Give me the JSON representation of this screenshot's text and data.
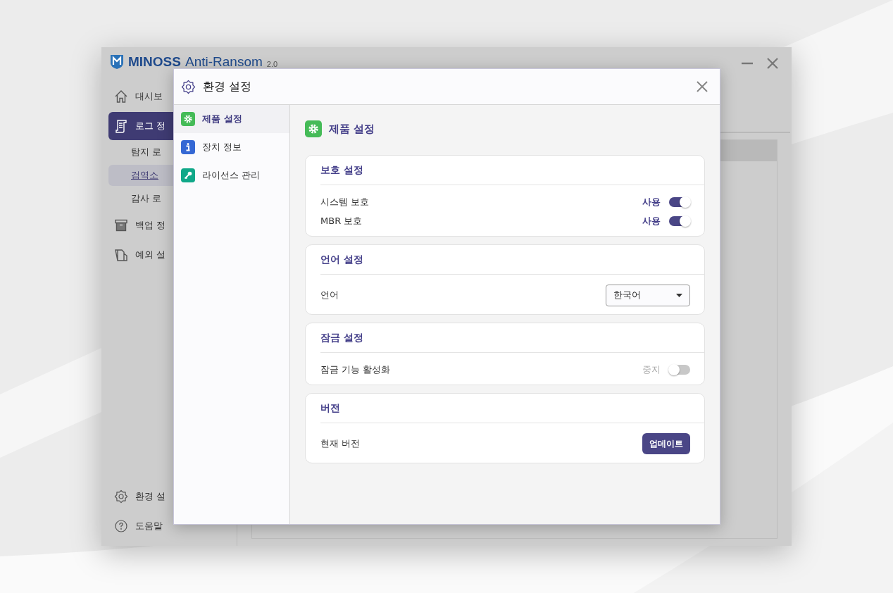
{
  "app": {
    "brand": "MINOSS",
    "product": "Anti-Ransom",
    "version": "2.0"
  },
  "sidebar": {
    "items": [
      {
        "label": "대시보",
        "selected": false
      },
      {
        "label": "로그 정",
        "selected": true,
        "children": [
          {
            "label": "탐지 로",
            "selected": false
          },
          {
            "label": "검역소",
            "selected": true
          },
          {
            "label": "감사 로",
            "selected": false
          }
        ]
      },
      {
        "label": "백업 정",
        "selected": false
      },
      {
        "label": "예외 설",
        "selected": false
      }
    ],
    "bottom_items": [
      {
        "label": "환경 설"
      },
      {
        "label": "도움말"
      }
    ]
  },
  "dialog": {
    "title": "환경 설정",
    "nav": [
      {
        "label": "제품 설정",
        "selected": true
      },
      {
        "label": "장치 정보",
        "selected": false
      },
      {
        "label": "라이선스 관리",
        "selected": false
      }
    ],
    "page_title": "제품 설정",
    "sections": [
      {
        "title": "보호 설정",
        "rows": [
          {
            "kind": "toggle",
            "label": "시스템 보호",
            "state_label": "사용",
            "on": true
          },
          {
            "kind": "toggle",
            "label": "MBR 보호",
            "state_label": "사용",
            "on": true
          }
        ]
      },
      {
        "title": "언어 설정",
        "rows": [
          {
            "kind": "select",
            "label": "언어",
            "value": "한국어"
          }
        ]
      },
      {
        "title": "잠금 설정",
        "rows": [
          {
            "kind": "toggle",
            "label": "잠금 기능 활성화",
            "state_label": "중지",
            "on": false
          }
        ]
      },
      {
        "title": "버전",
        "rows": [
          {
            "kind": "button",
            "label": "현재 버전",
            "button": "업데이트"
          }
        ]
      }
    ]
  }
}
